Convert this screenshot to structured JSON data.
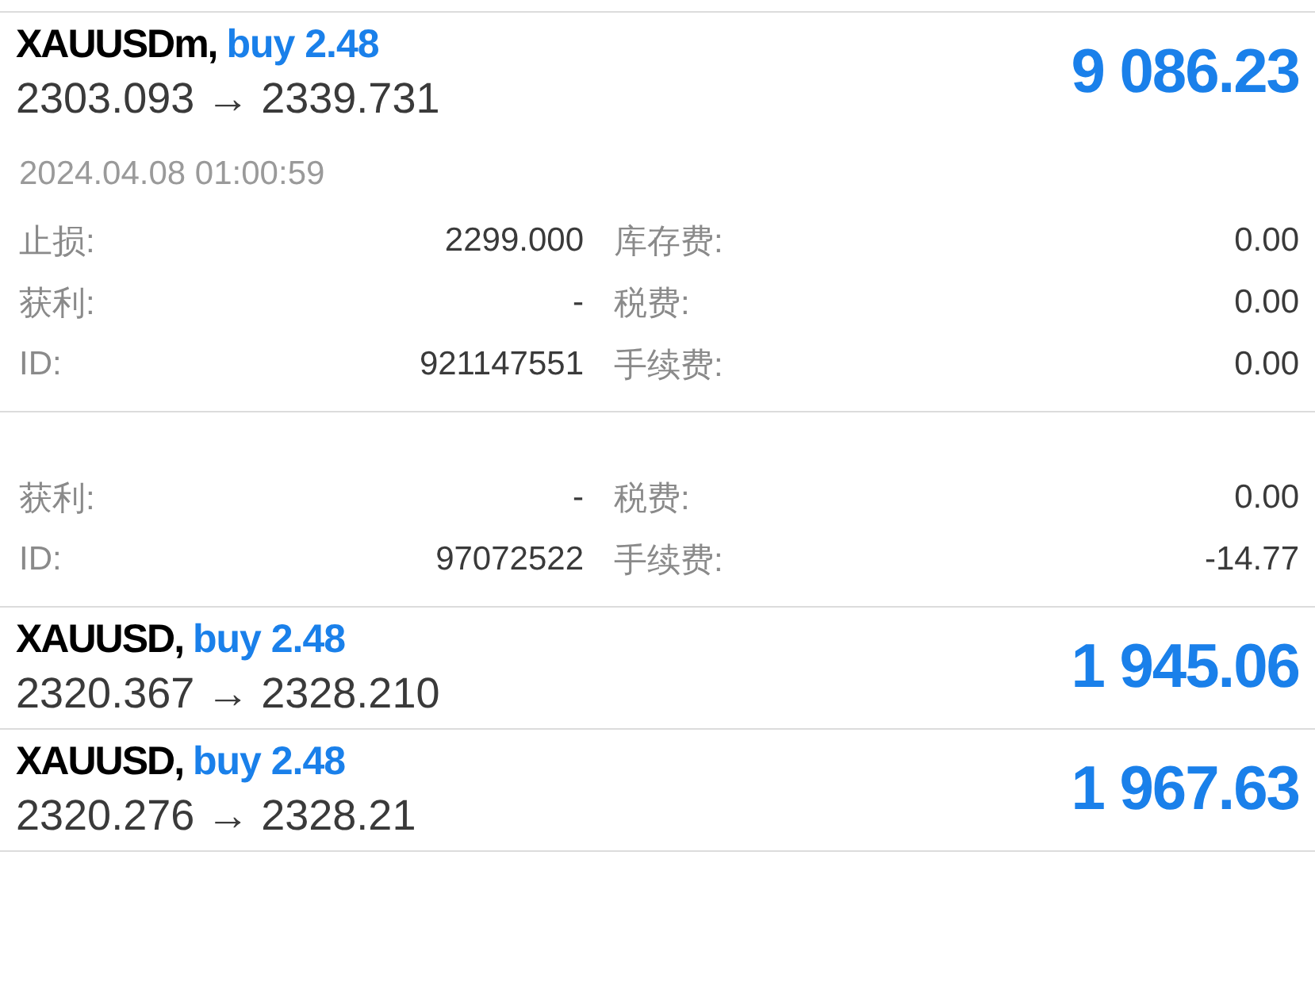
{
  "sections": [
    {
      "kind": "trade",
      "symbol": "XAUUSDm,",
      "side": "buy 2.48",
      "prices": "2303.093 → 2339.731",
      "profit": "9 086.23",
      "time": "2024.04.08 01:00:59",
      "rows": [
        {
          "cells": [
            {
              "label": "止损:",
              "value": "2299.000"
            },
            {
              "label": "库存费:",
              "value": "0.00"
            }
          ]
        },
        {
          "cells": [
            {
              "label": "获利:",
              "value": "-"
            },
            {
              "label": "税费:",
              "value": "0.00"
            }
          ]
        },
        {
          "cells": [
            {
              "label": "ID:",
              "value": "921147551"
            },
            {
              "label": "手续费:",
              "value": "0.00"
            }
          ]
        }
      ]
    },
    {
      "kind": "details",
      "rows": [
        {
          "cells": [
            {
              "label": "获利:",
              "value": "-"
            },
            {
              "label": "税费:",
              "value": "0.00"
            }
          ]
        },
        {
          "cells": [
            {
              "label": "ID:",
              "value": "97072522"
            },
            {
              "label": "手续费:",
              "value": "-14.77"
            }
          ]
        }
      ]
    },
    {
      "kind": "trade",
      "symbol": "XAUUSD,",
      "side": "buy 2.48",
      "prices": "2320.367 → 2328.210",
      "profit": "1 945.06"
    },
    {
      "kind": "trade",
      "symbol": "XAUUSD,",
      "side": "buy 2.48",
      "prices": "2320.276 → 2328.21",
      "profit": "1 967.63"
    }
  ]
}
